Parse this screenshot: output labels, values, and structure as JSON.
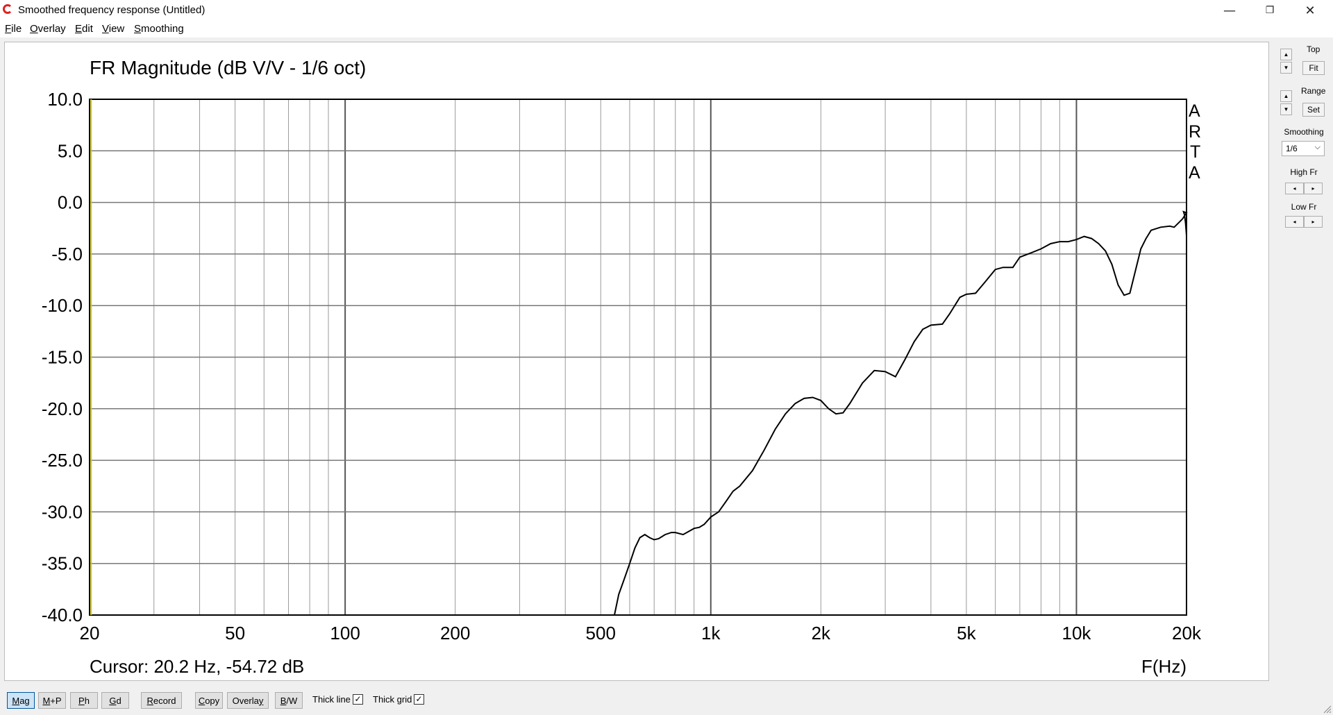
{
  "window": {
    "title": "Smoothed frequency response (Untitled)",
    "controls": {
      "minimize": "—",
      "restore": "❐",
      "close": "✕"
    },
    "icon": "arta-app-icon"
  },
  "menu": {
    "items": [
      {
        "key": "F",
        "rest": "ile"
      },
      {
        "key": "O",
        "rest": "verlay"
      },
      {
        "key": "E",
        "rest": "dit"
      },
      {
        "key": "V",
        "rest": "iew"
      },
      {
        "key": "S",
        "rest": "moothing"
      }
    ]
  },
  "plot": {
    "title": "FR Magnitude (dB V/V - 1/6 oct)",
    "cursor": "Cursor: 20.2 Hz, -54.72 dB",
    "x_axis_label": "F(Hz)",
    "watermark": [
      "A",
      "R",
      "T",
      "A"
    ]
  },
  "chart_data": {
    "type": "line",
    "title": "FR Magnitude (dB V/V - 1/6 oct)",
    "xlabel": "F(Hz)",
    "ylabel": "",
    "xscale": "log",
    "xlim": [
      20,
      20000
    ],
    "ylim": [
      -40,
      10
    ],
    "grid": true,
    "x_ticks": [
      {
        "v": 20,
        "label": "20"
      },
      {
        "v": 50,
        "label": "50"
      },
      {
        "v": 100,
        "label": "100"
      },
      {
        "v": 200,
        "label": "200"
      },
      {
        "v": 500,
        "label": "500"
      },
      {
        "v": 1000,
        "label": "1k"
      },
      {
        "v": 2000,
        "label": "2k"
      },
      {
        "v": 5000,
        "label": "5k"
      },
      {
        "v": 10000,
        "label": "10k"
      },
      {
        "v": 20000,
        "label": "20k"
      }
    ],
    "y_ticks": [
      {
        "v": 10,
        "label": "10.0"
      },
      {
        "v": 5,
        "label": "5.0"
      },
      {
        "v": 0,
        "label": "0.0"
      },
      {
        "v": -5,
        "label": "-5.0"
      },
      {
        "v": -10,
        "label": "-10.0"
      },
      {
        "v": -15,
        "label": "-15.0"
      },
      {
        "v": -20,
        "label": "-20.0"
      },
      {
        "v": -25,
        "label": "-25.0"
      },
      {
        "v": -30,
        "label": "-30.0"
      },
      {
        "v": -35,
        "label": "-35.0"
      },
      {
        "v": -40,
        "label": "-40.0"
      }
    ],
    "cursor_freq": 20.2,
    "series": [
      {
        "color": "#000000",
        "x": [
          545,
          560,
          580,
          600,
          620,
          640,
          660,
          680,
          700,
          720,
          750,
          780,
          800,
          840,
          880,
          900,
          930,
          960,
          1000,
          1050,
          1100,
          1150,
          1200,
          1300,
          1400,
          1500,
          1600,
          1700,
          1800,
          1900,
          2000,
          2100,
          2200,
          2300,
          2400,
          2600,
          2800,
          3000,
          3200,
          3400,
          3600,
          3800,
          4000,
          4300,
          4500,
          4800,
          5000,
          5300,
          5600,
          6000,
          6300,
          6700,
          7000,
          7500,
          8000,
          8500,
          9000,
          9500,
          10000,
          10500,
          11000,
          11500,
          12000,
          12500,
          13000,
          13500,
          14000,
          15000,
          15500,
          16000,
          17000,
          18000,
          18500,
          19000,
          19500,
          20000
        ],
        "y": [
          -40,
          -38,
          -36.5,
          -35,
          -33.5,
          -32.5,
          -32.2,
          -32.5,
          -32.7,
          -32.6,
          -32.2,
          -32,
          -32,
          -32.2,
          -31.8,
          -31.6,
          -31.5,
          -31.2,
          -30.5,
          -30,
          -29,
          -28,
          -27.5,
          -26,
          -24,
          -22,
          -20.5,
          -19.5,
          -19,
          -18.9,
          -19.2,
          -20,
          -20.5,
          -20.4,
          -19.5,
          -17.5,
          -16.3,
          -16.4,
          -16.9,
          -15.2,
          -13.5,
          -12.3,
          -11.9,
          -11.8,
          -10.8,
          -9.2,
          -8.9,
          -8.8,
          -7.8,
          -6.5,
          -6.3,
          -6.3,
          -5.3,
          -4.9,
          -4.5,
          -4,
          -3.8,
          -3.8,
          -3.6,
          -3.3,
          -3.5,
          -4,
          -4.7,
          -6,
          -8,
          -9,
          -8.8,
          -4.5,
          -3.5,
          -2.7,
          -2.4,
          -2.3,
          -2.4,
          -2,
          -1.6,
          -1
        ],
        "y_tail": [
          -0.9,
          -1.2,
          -2.0,
          -3.2
        ]
      }
    ]
  },
  "side": {
    "top_label": "Top",
    "fit_label": "Fit",
    "range_label": "Range",
    "set_label": "Set",
    "smoothing_label": "Smoothing",
    "smoothing_value": "1/6",
    "high_fr_label": "High Fr",
    "low_fr_label": "Low Fr"
  },
  "toolbar": {
    "mag": {
      "key": "M",
      "rest": "ag"
    },
    "mp": {
      "key": "M",
      "rest": "+P"
    },
    "ph": {
      "key": "P",
      "rest": "h"
    },
    "gd": {
      "key": "G",
      "rest": "d"
    },
    "record": {
      "key": "R",
      "rest": "ecord"
    },
    "copy": {
      "key": "C",
      "rest": "opy"
    },
    "overlay": {
      "pre": "Overla",
      "key": "y",
      "rest": ""
    },
    "bw": {
      "key": "B",
      "rest": "/W"
    },
    "thick_line": "Thick line",
    "thick_grid": "Thick grid",
    "thick_line_checked": true,
    "thick_grid_checked": true
  }
}
